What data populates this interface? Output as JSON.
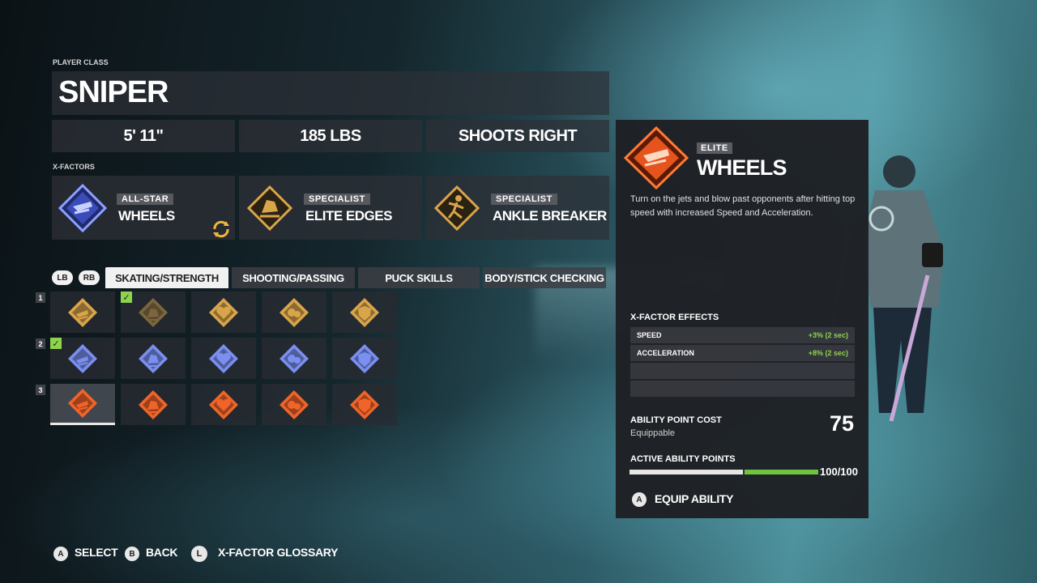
{
  "player_class": {
    "label": "PLAYER CLASS",
    "name": "SNIPER"
  },
  "stats": {
    "height": "5' 11\"",
    "weight": "185 LBS",
    "shoots": "SHOOTS RIGHT"
  },
  "xfactors": {
    "label": "X-FACTORS",
    "items": [
      {
        "tier": "ALL-STAR",
        "name": "WHEELS",
        "icon": "wheels-icon",
        "color": "#7a8ff0"
      },
      {
        "tier": "SPECIALIST",
        "name": "ELITE EDGES",
        "icon": "elite-edges-icon",
        "color": "#d9a54a"
      },
      {
        "tier": "SPECIALIST",
        "name": "ANKLE BREAKER",
        "icon": "ankle-breaker-icon",
        "color": "#d9a54a"
      }
    ]
  },
  "bumpers": {
    "left": "LB",
    "right": "RB"
  },
  "tabs": [
    {
      "label": "SKATING/STRENGTH",
      "active": true
    },
    {
      "label": "SHOOTING/PASSING",
      "active": false
    },
    {
      "label": "PUCK SKILLS",
      "active": false
    },
    {
      "label": "BODY/STICK CHECKING",
      "active": false
    }
  ],
  "grid": {
    "rows": [
      {
        "num": "1",
        "tier_color": "#d9a54a",
        "checked_col": 1
      },
      {
        "num": "2",
        "tier_color": "#7a8ff0",
        "checked_col": 0
      },
      {
        "num": "3",
        "tier_color": "#f0642a",
        "checked_col": -1
      }
    ],
    "selected": [
      2,
      0
    ]
  },
  "detail": {
    "tier": "ELITE",
    "name": "WHEELS",
    "description": "Turn on the jets and blow past opponents after hitting top speed with increased Speed and Acceleration.",
    "effects_title": "X-FACTOR EFFECTS",
    "effects": [
      {
        "name": "SPEED",
        "value": "+3% (2 sec)"
      },
      {
        "name": "ACCELERATION",
        "value": "+8% (2 sec)"
      },
      {
        "name": "",
        "value": ""
      },
      {
        "name": "",
        "value": ""
      }
    ],
    "cost_label": "ABILITY POINT COST",
    "cost_status": "Equippable",
    "cost_value": "75",
    "active_label": "ACTIVE ABILITY POINTS",
    "active_value": "100/100",
    "active_used_fraction": 0.6,
    "active_added_fraction": 0.4,
    "equip_button": "A",
    "equip_label": "EQUIP ABILITY",
    "accent": "#f0642a"
  },
  "footer": [
    {
      "button": "A",
      "label": "SELECT"
    },
    {
      "button": "B",
      "label": "BACK"
    },
    {
      "button": "L",
      "label": "X-FACTOR GLOSSARY"
    }
  ]
}
